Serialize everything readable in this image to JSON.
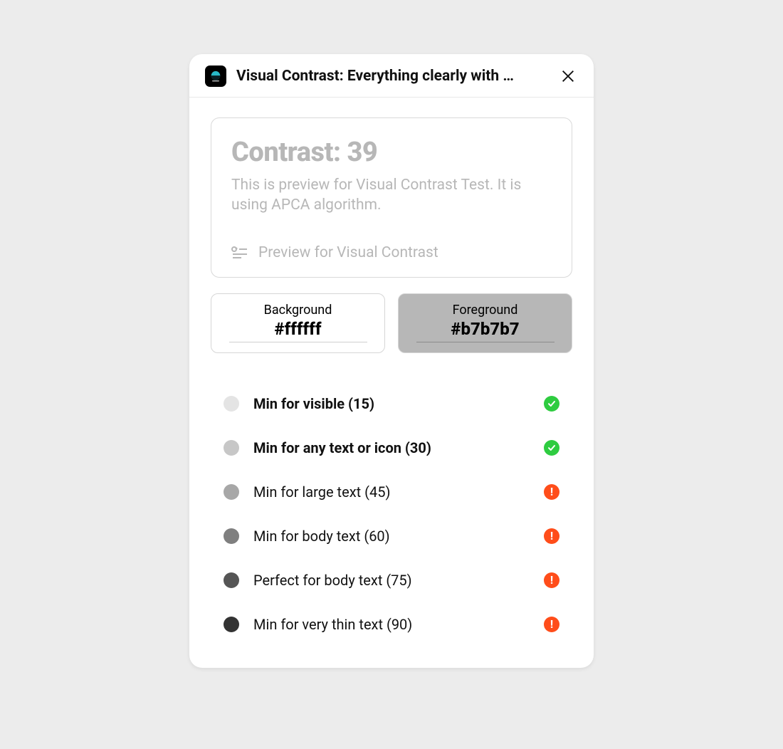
{
  "header": {
    "title": "Visual Contrast: Everything clearly with …"
  },
  "preview": {
    "heading": "Contrast: 39",
    "description": "This is preview for Visual Contrast Test. It is using APCA algorithm.",
    "caption": "Preview for Visual Contrast"
  },
  "swatches": {
    "background": {
      "label": "Background",
      "value": "#ffffff"
    },
    "foreground": {
      "label": "Foreground",
      "value": "#b7b7b7"
    }
  },
  "criteria": [
    {
      "label": "Min for visible (15)",
      "shade": "#e4e4e4",
      "passed": true,
      "bold": true
    },
    {
      "label": "Min for any text or icon (30)",
      "shade": "#c7c7c7",
      "passed": true,
      "bold": true
    },
    {
      "label": "Min for large text (45)",
      "shade": "#a7a7a7",
      "passed": false,
      "bold": false
    },
    {
      "label": "Min for body text (60)",
      "shade": "#7f7f7f",
      "passed": false,
      "bold": false
    },
    {
      "label": "Perfect for body text (75)",
      "shade": "#555555",
      "passed": false,
      "bold": false
    },
    {
      "label": "Min for very thin text (90)",
      "shade": "#333333",
      "passed": false,
      "bold": false
    }
  ]
}
